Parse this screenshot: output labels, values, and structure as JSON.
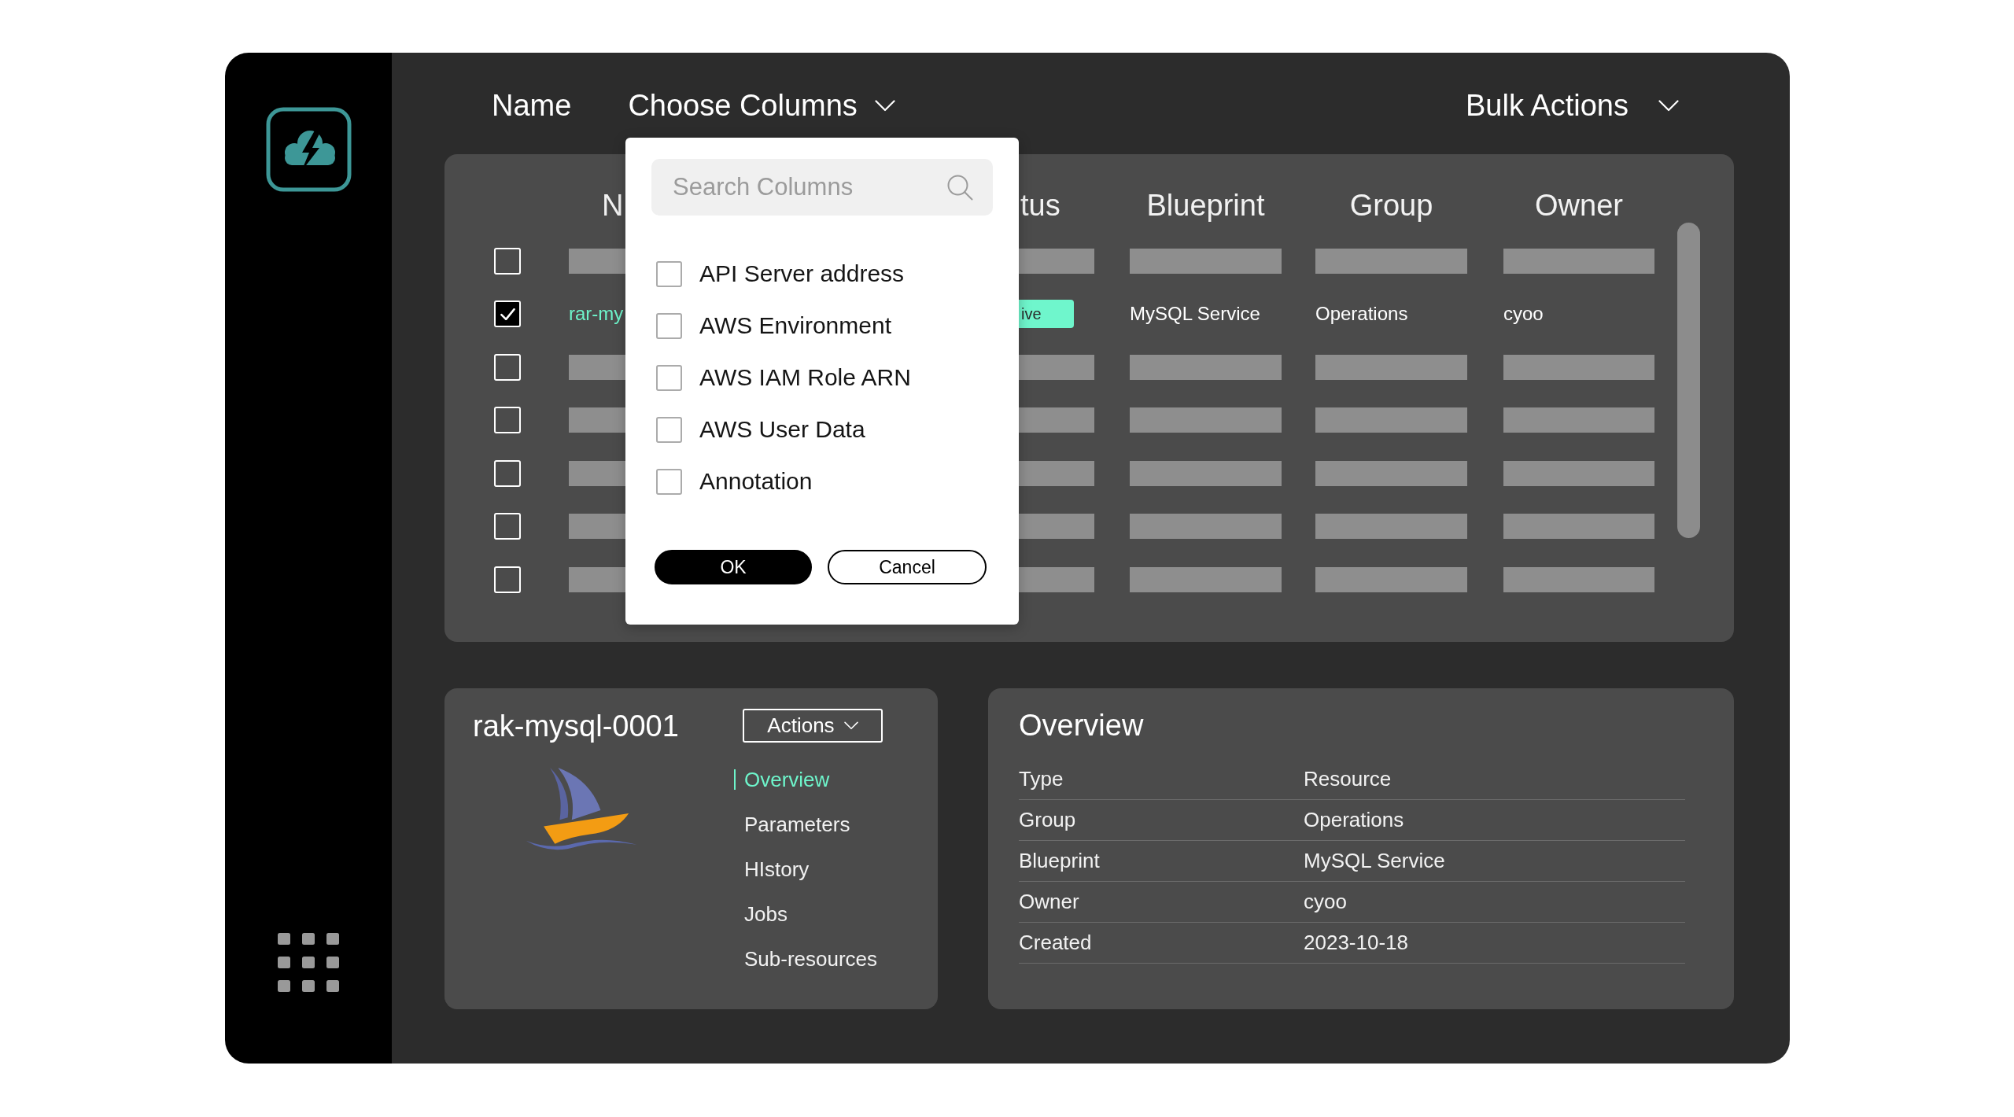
{
  "header": {
    "name_button": "Name",
    "columns_menu": {
      "label": "Choose Columns",
      "expanded": true,
      "panel": {
        "search": {
          "placeholder": "Search Columns"
        },
        "options": [
          {
            "label": "API Server address",
            "checked": false
          },
          {
            "label": "AWS Environment",
            "checked": false
          },
          {
            "label": "AWS IAM Role ARN",
            "checked": false
          },
          {
            "label": "AWS User Data",
            "checked": false
          },
          {
            "label": "Annotation",
            "checked": false
          }
        ],
        "buttons": [
          {
            "label": "OK",
            "kind": "primary"
          },
          {
            "label": "Cancel",
            "kind": "secondary"
          }
        ]
      }
    },
    "bulk_actions": "Bulk Actions"
  },
  "table": {
    "columns": [
      {
        "label": "N",
        "kind": "name"
      },
      {
        "label": "tus",
        "kind": "status"
      },
      {
        "label": "Blueprint",
        "kind": "text"
      },
      {
        "label": "Group",
        "kind": "text"
      },
      {
        "label": "Owner",
        "kind": "text"
      }
    ],
    "rows": [
      {
        "kind": "placeholder",
        "selected": false
      },
      {
        "kind": "data",
        "selected": true,
        "cells": [
          "rar-my",
          "ive",
          "MySQL Service",
          "Operations",
          "cyoo"
        ]
      },
      {
        "kind": "placeholder",
        "selected": false
      },
      {
        "kind": "placeholder",
        "selected": false
      },
      {
        "kind": "placeholder",
        "selected": false
      },
      {
        "kind": "placeholder",
        "selected": false
      },
      {
        "kind": "placeholder",
        "selected": false
      }
    ]
  },
  "resource": {
    "title": "rak-mysql-0001",
    "actions_button": "Actions",
    "nav": [
      {
        "label": "Overview",
        "selected": true
      },
      {
        "label": "Parameters",
        "selected": false
      },
      {
        "label": "HIstory",
        "selected": false
      },
      {
        "label": "Jobs",
        "selected": false
      },
      {
        "label": "Sub-resources",
        "selected": false
      }
    ]
  },
  "overview": {
    "title": "Overview",
    "fields": [
      {
        "label": "Type",
        "value": "Resource"
      },
      {
        "label": "Group",
        "value": "Operations"
      },
      {
        "label": "Blueprint",
        "value": "MySQL Service"
      },
      {
        "label": "Owner",
        "value": "cyoo"
      },
      {
        "label": "Created",
        "value": "2023-10-18"
      }
    ]
  }
}
